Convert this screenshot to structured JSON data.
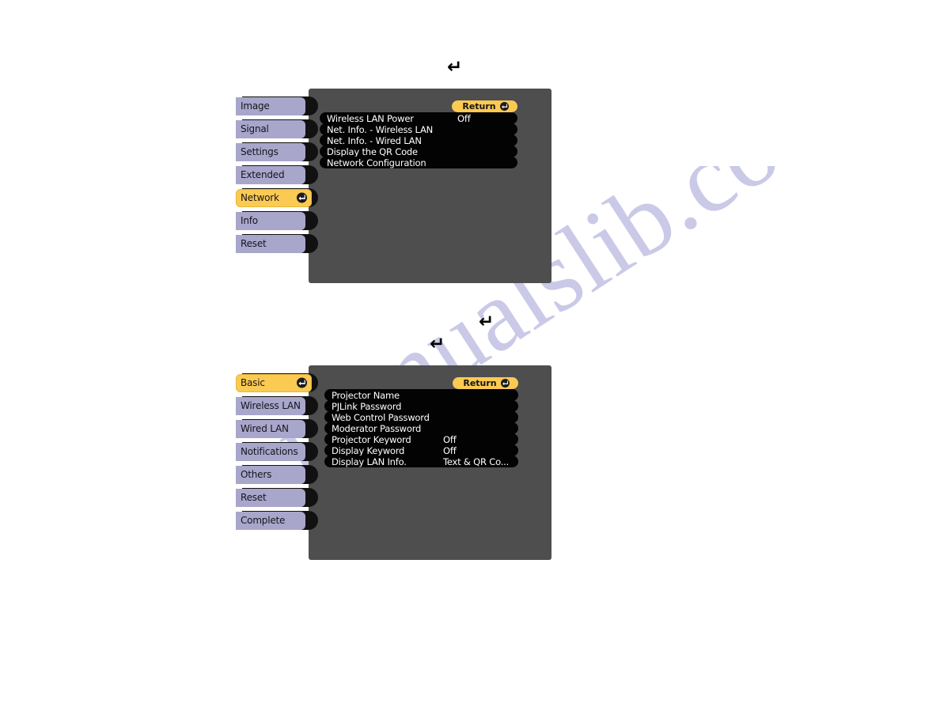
{
  "watermark": {
    "text": "manualslib.com"
  },
  "colors": {
    "panel_bg": "#4e4e4e",
    "tab_bg": "#a9a6cc",
    "tab_selected_bg": "#fbca52",
    "row_bg": "#030303",
    "row_text": "#ffffff",
    "tab_text": "#15151c"
  },
  "arrows": {
    "enter_glyph": "↵",
    "top": {
      "label": "enter-key-arrow"
    },
    "middle_right": {
      "label": "enter-key-arrow"
    },
    "middle_left": {
      "label": "enter-key-arrow"
    }
  },
  "menus": [
    {
      "id": "network-menu",
      "tabs": [
        {
          "label": "Image",
          "selected": false
        },
        {
          "label": "Signal",
          "selected": false
        },
        {
          "label": "Settings",
          "selected": false
        },
        {
          "label": "Extended",
          "selected": false
        },
        {
          "label": "Network",
          "selected": true
        },
        {
          "label": "Info",
          "selected": false
        },
        {
          "label": "Reset",
          "selected": false
        }
      ],
      "return_label": "Return",
      "rows": [
        {
          "label": "Wireless LAN Power",
          "value": "Off"
        },
        {
          "label": "Net. Info. - Wireless LAN",
          "value": ""
        },
        {
          "label": "Net. Info. - Wired LAN",
          "value": ""
        },
        {
          "label": "Display the QR Code",
          "value": ""
        },
        {
          "label": "Network Configuration",
          "value": ""
        }
      ]
    },
    {
      "id": "network-configuration-menu",
      "tabs": [
        {
          "label": "Basic",
          "selected": true
        },
        {
          "label": "Wireless LAN",
          "selected": false
        },
        {
          "label": "Wired LAN",
          "selected": false
        },
        {
          "label": "Notifications",
          "selected": false
        },
        {
          "label": "Others",
          "selected": false
        },
        {
          "label": "Reset",
          "selected": false
        },
        {
          "label": "Complete",
          "selected": false
        }
      ],
      "return_label": "Return",
      "rows": [
        {
          "label": "Projector Name",
          "value": ""
        },
        {
          "label": "PJLink Password",
          "value": ""
        },
        {
          "label": "Web Control Password",
          "value": ""
        },
        {
          "label": "Moderator Password",
          "value": ""
        },
        {
          "label": "Projector Keyword",
          "value": "Off"
        },
        {
          "label": "Display Keyword",
          "value": "Off"
        },
        {
          "label": "Display LAN Info.",
          "value": "Text & QR Co..."
        }
      ]
    }
  ]
}
